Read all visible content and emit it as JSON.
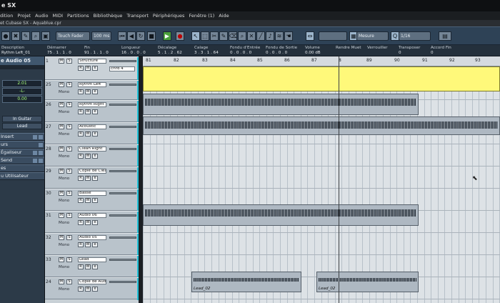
{
  "window": {
    "title": "e SX"
  },
  "menu": [
    "dition",
    "Projet",
    "Audio",
    "MIDI",
    "Partitions",
    "Bibliothèque",
    "Transport",
    "Périphériques",
    "Fenêtre (1)",
    "Aide"
  ],
  "project": {
    "title": "et Cubase SX - Aquablue.cpr"
  },
  "toolbar": {
    "fader": "Touch Fader",
    "time": "100 ms",
    "snap": "Mesure",
    "quantize": "1/16"
  },
  "infoline": {
    "labels": [
      "Description",
      "Démarrer",
      "Fin",
      "Longueur",
      "Décalage",
      "Calage",
      "Fondu d'Entrée",
      "Fondu de Sortie",
      "Volume",
      "Rendre Muet",
      "Verrouiller",
      "Transposer",
      "Accord Fin"
    ],
    "values": [
      "Rythm Left_01",
      "75 . 1 . 1 . 0",
      "91 . 1 . 1 . 0",
      "16 . 0 . 0 . 0",
      "5 . 1 . 2 . 62",
      "3 . 3 . 1 . 64",
      "0 . 0 . 0 . 0",
      "0 . 0 . 0 . 0",
      "0.00 dB",
      "",
      "",
      "0",
      "0"
    ]
  },
  "inspector": {
    "header": "e Audio 05",
    "volume": "2.01",
    "pan": "-L-",
    "value3": "0.00",
    "input": "In Guitar",
    "output": "Lead",
    "sections": [
      "Insert",
      "urs",
      "Égaliseur",
      "Send",
      "es",
      "u Utilisateur"
    ]
  },
  "ruler": {
    "marks": [
      "81",
      "82",
      "83",
      "84",
      "85",
      "86",
      "87",
      "8",
      "89",
      "90",
      "91",
      "92",
      "93"
    ]
  },
  "tracks": [
    {
      "num": "1",
      "name": "Structure",
      "sub": "",
      "extra": "chrd 4"
    },
    {
      "num": "25",
      "name": "Rythm Left",
      "sub": "Mono",
      "extra": ""
    },
    {
      "num": "26",
      "name": "Rythm Right",
      "sub": "Mono",
      "extra": ""
    },
    {
      "num": "27",
      "name": "Acoustic",
      "sub": "Mono",
      "extra": ""
    },
    {
      "num": "28",
      "name": "Clean Right",
      "sub": "Mono",
      "extra": ""
    },
    {
      "num": "29",
      "name": "Copie de Clear",
      "sub": "Mono",
      "extra": ""
    },
    {
      "num": "30",
      "name": "Basse",
      "sub": "Mono",
      "extra": ""
    },
    {
      "num": "31",
      "name": "Audio 06",
      "sub": "Mono",
      "extra": ""
    },
    {
      "num": "32",
      "name": "Audio 05",
      "sub": "Mono",
      "extra": ""
    },
    {
      "num": "33",
      "name": "Lead",
      "sub": "Mono",
      "extra": ""
    },
    {
      "num": "24",
      "name": "Copie de Audio",
      "sub": "Mono",
      "extra": ""
    }
  ],
  "parts": [
    {
      "lane": 1,
      "label": ""
    },
    {
      "lane": 2,
      "label": ""
    },
    {
      "lane": 6,
      "label": ""
    },
    {
      "lane": 9,
      "label": "Lead_02"
    },
    {
      "lane": 9,
      "label": "Lead_02"
    }
  ],
  "buttons": {
    "m": "M",
    "s": "S",
    "r": "R",
    "w": "W",
    "e": "e"
  }
}
